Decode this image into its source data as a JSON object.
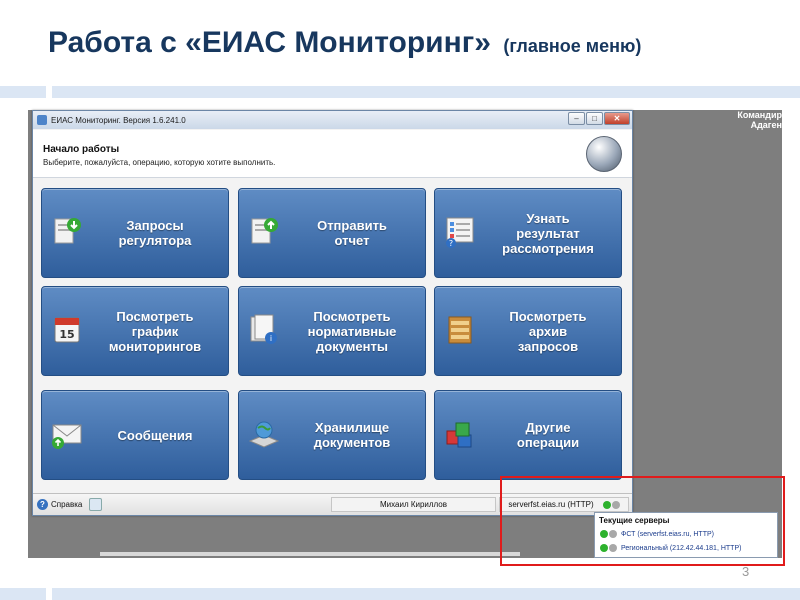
{
  "slide": {
    "title": "Работа с «ЕИАС Мониторинг»",
    "subtitle": "(главное меню)",
    "page_number": "3"
  },
  "desktop": {
    "corner_line1": "Командир",
    "corner_line2": "Адаген"
  },
  "window": {
    "title": "ЕИАС Мониторинг. Версия 1.6.241.0",
    "minimize_icon": "minimize-icon",
    "maximize_icon": "maximize-icon",
    "close_icon": "close-icon"
  },
  "header": {
    "title": "Начало работы",
    "subtitle": "Выберите, пожалуйста, операцию, которую хотите выполнить."
  },
  "tiles": [
    {
      "label": "Запросы\nрегулятора",
      "icon": "download-document-icon"
    },
    {
      "label": "Отправить\nотчет",
      "icon": "upload-document-icon"
    },
    {
      "label": "Узнать\nрезультат\nрассмотрения",
      "icon": "checklist-help-icon"
    },
    {
      "label": "Посмотреть\nграфик\nмониторингов",
      "icon": "calendar-icon"
    },
    {
      "label": "Посмотреть\nнормативные\nдокументы",
      "icon": "document-info-icon"
    },
    {
      "label": "Посмотреть\nархив\nзапросов",
      "icon": "archive-shelf-icon"
    },
    {
      "label": "Сообщения",
      "icon": "envelope-icon"
    },
    {
      "label": "Хранилище\nдокументов",
      "icon": "globe-storage-icon"
    },
    {
      "label": "Другие\nоперации",
      "icon": "cubes-icon"
    }
  ],
  "statusbar": {
    "help_label": "Справка",
    "user": "Михаил Кириллов",
    "server": "serverfst.eias.ru (HTTP)"
  },
  "servers_popup": {
    "title": "Текущие серверы",
    "rows": [
      "ФСТ (serverfst.eias.ru, HTTP)",
      "Региональный (212.42.44.181, HTTP)"
    ]
  },
  "colors": {
    "title": "#17375e",
    "tile": "#3f6dab",
    "highlight": "#e01b1b",
    "status_ok": "#2db22d"
  }
}
